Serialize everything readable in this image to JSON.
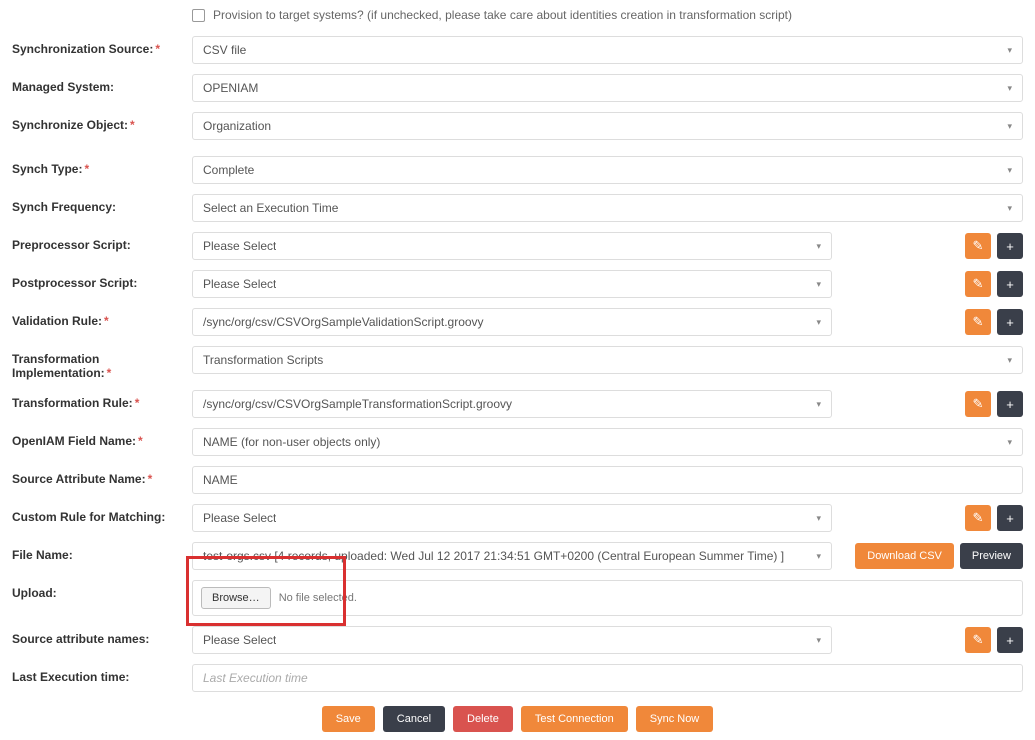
{
  "checkbox": {
    "label": "Provision to target systems? (if unchecked, please take care about identities creation in transformation script)"
  },
  "labels": {
    "sync_source": "Synchronization Source:",
    "managed_system": "Managed System:",
    "sync_object": "Synchronize Object:",
    "synch_type": "Synch Type:",
    "synch_freq": "Synch Frequency:",
    "preprocessor": "Preprocessor Script:",
    "postprocessor": "Postprocessor Script:",
    "validation": "Validation Rule:",
    "transform_impl": "Transformation Implementation:",
    "transform_rule": "Transformation Rule:",
    "openiam_field": "OpenIAM Field Name:",
    "source_attr": "Source Attribute Name:",
    "custom_rule": "Custom Rule for Matching:",
    "file_name": "File Name:",
    "upload": "Upload:",
    "source_attr_names": "Source attribute names:",
    "last_exec": "Last Execution time:"
  },
  "values": {
    "sync_source": "CSV file",
    "managed_system": "OPENIAM",
    "sync_object": "Organization",
    "synch_type": "Complete",
    "synch_freq": "Select an Execution Time",
    "preprocessor": "Please Select",
    "postprocessor": "Please Select",
    "validation": "/sync/org/csv/CSVOrgSampleValidationScript.groovy",
    "transform_impl": "Transformation Scripts",
    "transform_rule": "/sync/org/csv/CSVOrgSampleTransformationScript.groovy",
    "openiam_field": "NAME (for non-user objects only)",
    "source_attr": "NAME",
    "custom_rule": "Please Select",
    "file_name": "test-orgs.csv [4 records, uploaded: Wed Jul 12 2017 21:34:51 GMT+0200 (Central European Summer Time) ]",
    "browse": "Browse…",
    "nofile": "No file selected.",
    "source_attr_names": "Please Select",
    "last_exec_ph": "Last Execution time"
  },
  "buttons": {
    "download_csv": "Download CSV",
    "preview": "Preview",
    "save": "Save",
    "cancel": "Cancel",
    "delete": "Delete",
    "test_conn": "Test Connection",
    "sync_now": "Sync Now"
  },
  "icons": {
    "edit": "✎",
    "plus": "+",
    "caret": "▾"
  }
}
